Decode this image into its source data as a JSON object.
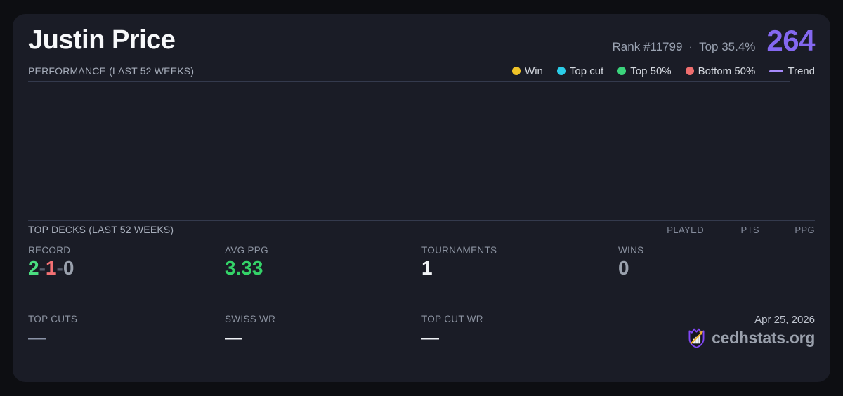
{
  "header": {
    "name": "Justin Price",
    "rank": "Rank #11799",
    "separator": "·",
    "top_pct": "Top 35.4%",
    "score": "264"
  },
  "performance": {
    "title": "PERFORMANCE (LAST 52 WEEKS)",
    "legend": {
      "win": {
        "label": "Win",
        "color": "#f0c428"
      },
      "top_cut": {
        "label": "Top cut",
        "color": "#2bcde8"
      },
      "top50": {
        "label": "Top 50%",
        "color": "#3bd47c"
      },
      "bottom50": {
        "label": "Bottom 50%",
        "color": "#ef6e6e"
      },
      "trend": {
        "label": "Trend",
        "color": "#a78bfa"
      }
    }
  },
  "chart_data": {
    "type": "scatter",
    "title": "PERFORMANCE (LAST 52 WEEKS)",
    "points": [],
    "legend_entries": [
      "Win",
      "Top cut",
      "Top 50%",
      "Bottom 50%",
      "Trend"
    ],
    "grid": false,
    "note_visible_content": "chart plot area is empty"
  },
  "decks": {
    "title": "TOP DECKS (LAST 52 WEEKS)",
    "columns": [
      "PLAYED",
      "PTS",
      "PPG"
    ],
    "rows": []
  },
  "stats": {
    "record": {
      "label": "RECORD",
      "wins": "2",
      "sep1": "-",
      "losses": "1",
      "sep2": "-",
      "draws": "0"
    },
    "avg_ppg": {
      "label": "AVG PPG",
      "value": "3.33"
    },
    "tournaments": {
      "label": "TOURNAMENTS",
      "value": "1"
    },
    "wins": {
      "label": "WINS",
      "value": "0"
    },
    "top_cuts": {
      "label": "TOP CUTS",
      "value": "—"
    },
    "swiss_wr": {
      "label": "SWISS WR",
      "value": "—"
    },
    "top_cut_wr": {
      "label": "TOP CUT WR",
      "value": "—"
    }
  },
  "footer": {
    "date": "Apr 25, 2026",
    "brand": "cedhstats.org"
  },
  "colors": {
    "accent_purple": "#8468f0",
    "trend_purple": "#a78bfa",
    "win_yellow": "#f0c428",
    "top_cut_cyan": "#2bcde8",
    "top50_green": "#3bd47c",
    "bottom50_red": "#ef6e6e",
    "record_win_green": "#4ade80",
    "record_loss_red": "#f47174",
    "ppg_green": "#34d368",
    "card_bg": "#1a1c26",
    "page_bg": "#0d0e12"
  }
}
